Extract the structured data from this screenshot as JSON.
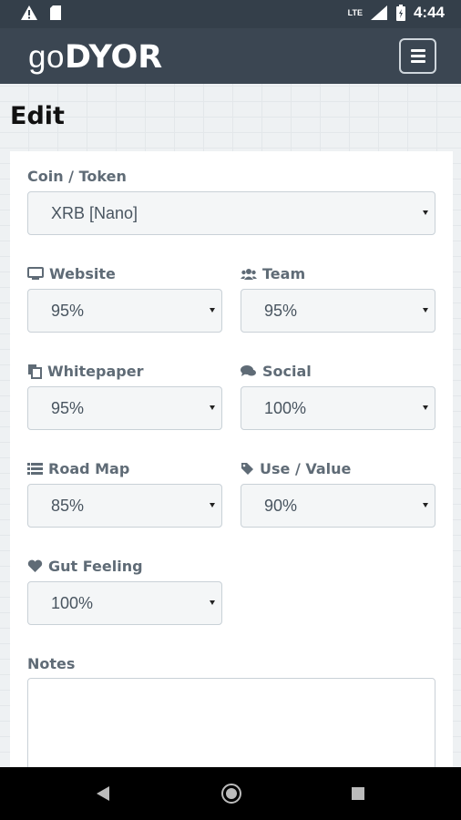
{
  "status_bar": {
    "time": "4:44",
    "network": "LTE",
    "icons": [
      "warning-icon",
      "sd-card-icon",
      "signal-icon",
      "battery-icon"
    ]
  },
  "navbar": {
    "brand_light": "go",
    "brand_bold": "DYOR",
    "menu_icon": "hamburger-icon"
  },
  "page": {
    "title": "Edit"
  },
  "form": {
    "coin": {
      "label": "Coin / Token",
      "value": "XRB [Nano]"
    },
    "website": {
      "label": "Website",
      "value": "95%",
      "icon": "monitor-icon"
    },
    "team": {
      "label": "Team",
      "value": "95%",
      "icon": "users-icon"
    },
    "whitepaper": {
      "label": "Whitepaper",
      "value": "95%",
      "icon": "files-icon"
    },
    "social": {
      "label": "Social",
      "value": "100%",
      "icon": "comments-icon"
    },
    "roadmap": {
      "label": "Road Map",
      "value": "85%",
      "icon": "list-icon"
    },
    "use_value": {
      "label": "Use / Value",
      "value": "90%",
      "icon": "tag-icon"
    },
    "gut_feeling": {
      "label": "Gut Feeling",
      "value": "100%",
      "icon": "heart-icon"
    },
    "notes": {
      "label": "Notes",
      "value": ""
    }
  },
  "system_nav": {
    "buttons": [
      "back-icon",
      "home-icon",
      "recents-icon"
    ]
  },
  "colors": {
    "status_bar": "#343f4a",
    "navbar": "#3b4652",
    "label": "#5f6b76",
    "select_bg": "#f4f6f7"
  }
}
